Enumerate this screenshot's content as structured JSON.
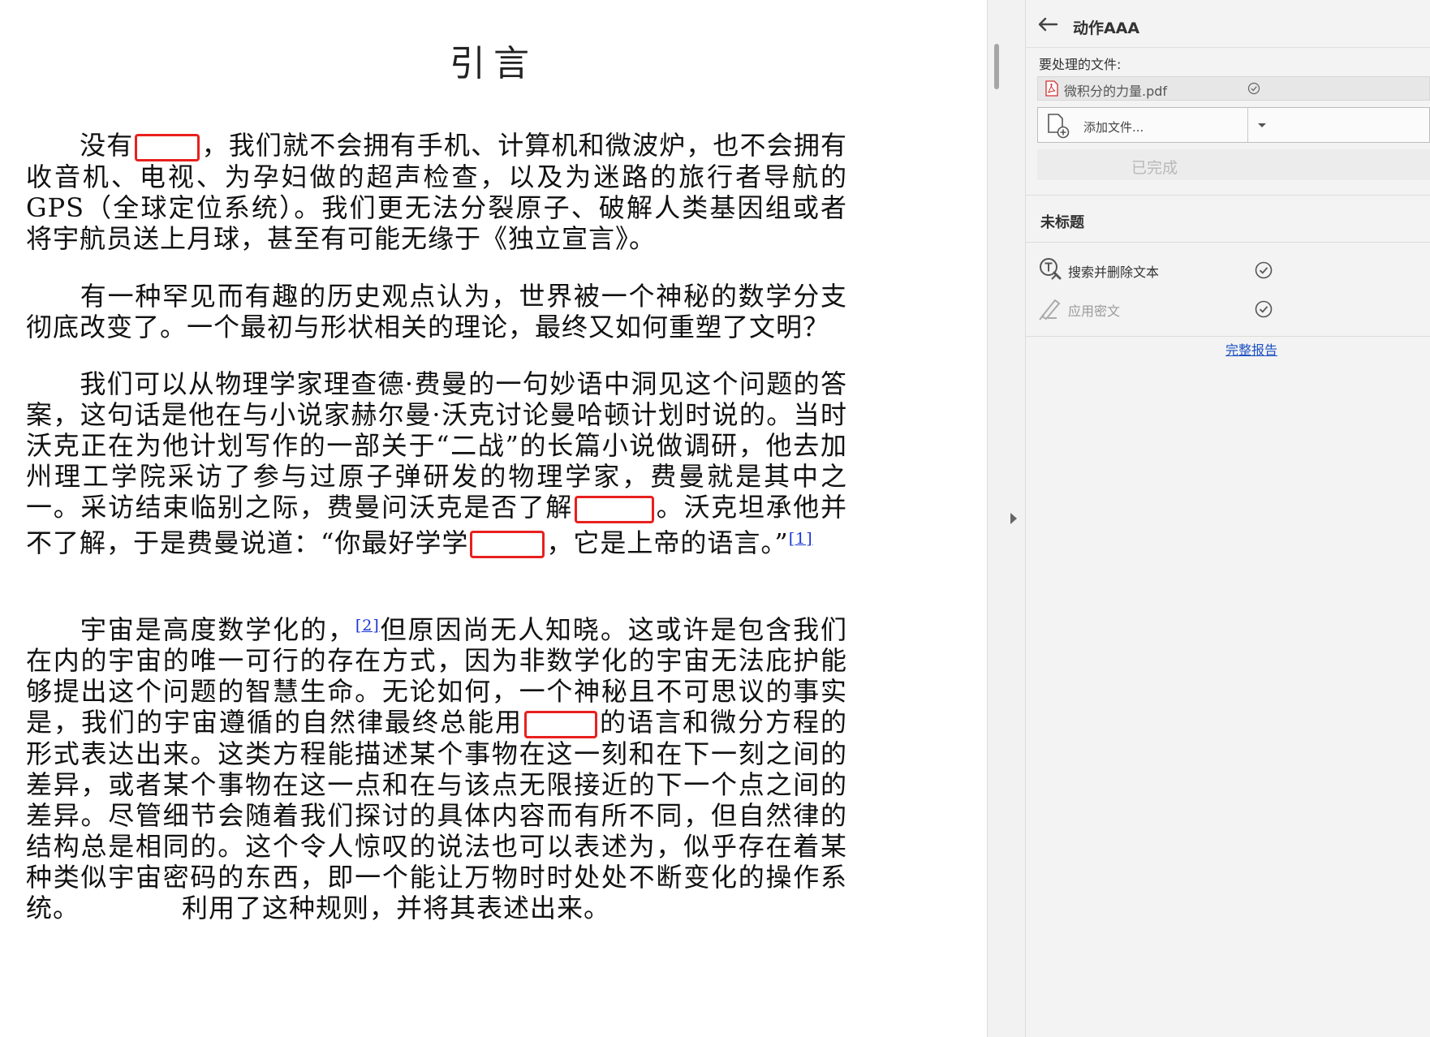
{
  "document": {
    "title": "引言",
    "paragraphs": [
      {
        "p1": "没有",
        "p2": "，我们就不会拥有手机、计算机和微波炉，也不会拥有收音机、电视、为孕妇做的超声检查，以及为迷路的旅行者导航的GPS（全球定位系统）。我们更无法分裂原子、破解人类基因组或者将宇航员送上月球，甚至有可能无缘于《独立宣言》。"
      },
      {
        "p1": "有一种罕见而有趣的历史观点认为，世界被一个神秘的数学分支彻底改变了。一个最初与形状相关的理论，最终又如何重塑了文明？"
      },
      {
        "p1": "我们可以从物理学家理查德·费曼的一句妙语中洞见这个问题的答案，这句话是他在与小说家赫尔曼·沃克讨论曼哈顿计划时说的。当时沃克正在为他计划写作的一部关于“二战”的长篇小说做调研，他去加州理工学院采访了参与过原子弹研发的物理学家，费曼就是其中之一。采访结束临别之际，费曼问沃克是否了解",
        "p2": "。沃克坦承他并不了解，于是费曼说道：“你最好学学",
        "p3": "，它是上帝的语言。”",
        "footnote": "[1]"
      },
      {
        "p1": "宇宙是高度数学化的，",
        "footnote": "[2]",
        "p2": "但原因尚无人知晓。这或许是包含我们在内的宇宙的唯一可行的存在方式，因为非数学化的宇宙无法庇护能够提出这个问题的智慧生命。无论如何，一个神秘且不可思议的事实是，我们的宇宙遵循的自然律最终总能用",
        "p3": "的语言和微分方程的形式表达出来。这类方程能描述某个事物在这一刻和在下一刻之间的差异，或者某个事物在这一点和在与该点无限接近的下一个点之间的差异。尽管细节会随着我们探讨的具体内容而有所不同，但自然律的结构总是相同的。这个令人惊叹的说法也可以表述为，似乎存在着某种类似宇宙密码的东西，即一个能让万物时时处处不断变化的操作系统。",
        "p4": "利用了这种规则，并将其表述出来。"
      }
    ]
  },
  "panel": {
    "title": "动作AAA",
    "files_label": "要处理的文件:",
    "file_name": "微积分的力量.pdf",
    "add_file_label": "添加文件...",
    "done_label": "已完成",
    "section_title": "未标题",
    "actions": [
      {
        "label": "搜索并删除文本",
        "state": "enabled"
      },
      {
        "label": "应用密文",
        "state": "disabled"
      }
    ],
    "full_report_label": "完整报告"
  },
  "colors": {
    "redaction_box": "#e8201e",
    "link": "#1a4fc4",
    "panel_bg": "#f3f3f3"
  }
}
